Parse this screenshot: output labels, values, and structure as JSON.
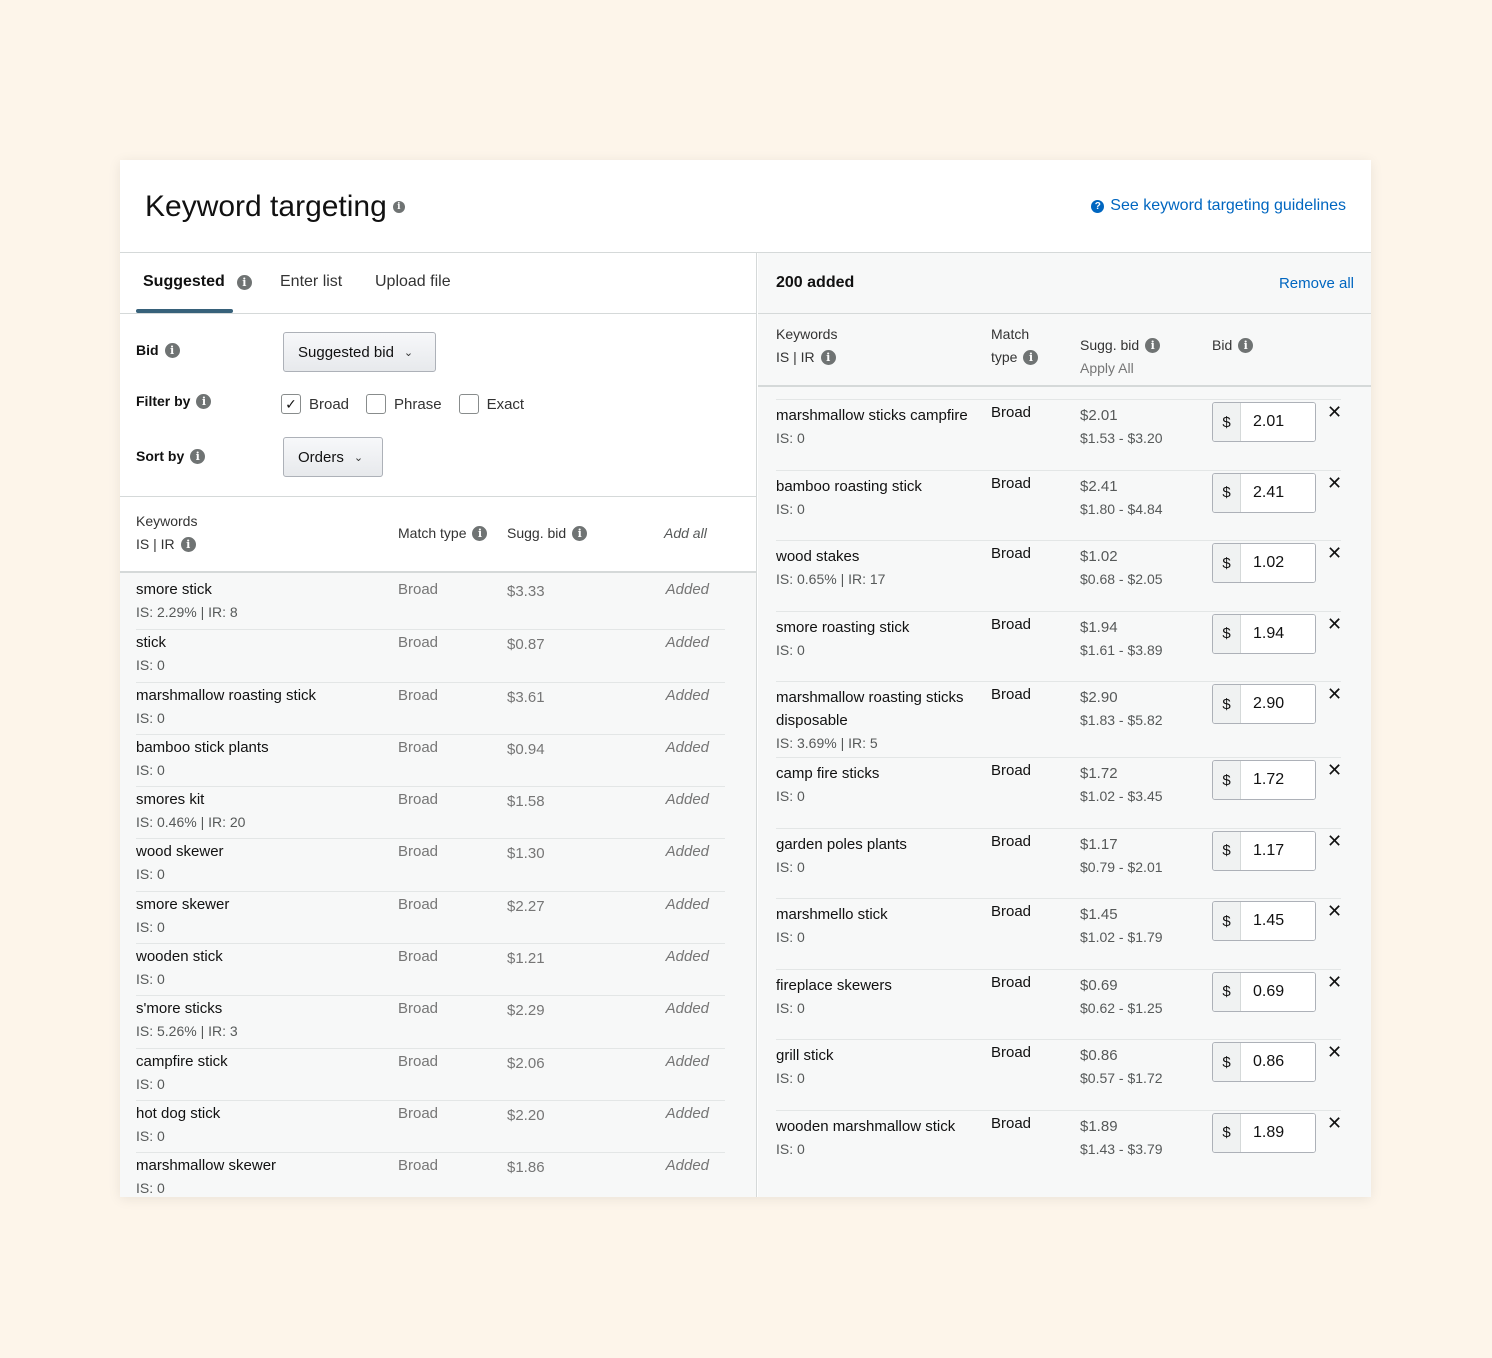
{
  "header": {
    "title": "Keyword targeting",
    "guidelines_link": "See keyword targeting guidelines"
  },
  "left": {
    "tabs": [
      "Suggested",
      "Enter list",
      "Upload file"
    ],
    "bid_label": "Bid",
    "bid_value": "Suggested bid",
    "filter_label": "Filter by",
    "filters": [
      {
        "label": "Broad",
        "checked": true
      },
      {
        "label": "Phrase",
        "checked": false
      },
      {
        "label": "Exact",
        "checked": false
      }
    ],
    "sort_label": "Sort by",
    "sort_value": "Orders",
    "columns": {
      "keywords": "Keywords",
      "is_ir": "IS | IR",
      "match_type": "Match type",
      "sugg_bid": "Sugg. bid",
      "add_all": "Add all"
    },
    "rows": [
      {
        "keyword": "smore stick",
        "is": "IS: 2.29% | IR: 8",
        "match": "Broad",
        "bid": "$3.33",
        "status": "Added"
      },
      {
        "keyword": "stick",
        "is": "IS: 0",
        "match": "Broad",
        "bid": "$0.87",
        "status": "Added"
      },
      {
        "keyword": "marshmallow roasting stick",
        "is": "IS: 0",
        "match": "Broad",
        "bid": "$3.61",
        "status": "Added"
      },
      {
        "keyword": "bamboo stick plants",
        "is": "IS: 0",
        "match": "Broad",
        "bid": "$0.94",
        "status": "Added"
      },
      {
        "keyword": "smores kit",
        "is": "IS: 0.46% | IR: 20",
        "match": "Broad",
        "bid": "$1.58",
        "status": "Added"
      },
      {
        "keyword": "wood skewer",
        "is": "IS: 0",
        "match": "Broad",
        "bid": "$1.30",
        "status": "Added"
      },
      {
        "keyword": "smore skewer",
        "is": "IS: 0",
        "match": "Broad",
        "bid": "$2.27",
        "status": "Added"
      },
      {
        "keyword": "wooden stick",
        "is": "IS: 0",
        "match": "Broad",
        "bid": "$1.21",
        "status": "Added"
      },
      {
        "keyword": "s'more sticks",
        "is": "IS: 5.26% | IR: 3",
        "match": "Broad",
        "bid": "$2.29",
        "status": "Added"
      },
      {
        "keyword": "campfire stick",
        "is": "IS: 0",
        "match": "Broad",
        "bid": "$2.06",
        "status": "Added"
      },
      {
        "keyword": "hot dog stick",
        "is": "IS: 0",
        "match": "Broad",
        "bid": "$2.20",
        "status": "Added"
      },
      {
        "keyword": "marshmallow skewer",
        "is": "IS: 0",
        "match": "Broad",
        "bid": "$1.86",
        "status": "Added"
      }
    ]
  },
  "right": {
    "added_count": "200 added",
    "remove_all": "Remove all",
    "columns": {
      "keywords": "Keywords",
      "is_ir": "IS | IR",
      "match_1": "Match",
      "match_2": "type",
      "sugg_bid": "Sugg. bid",
      "apply_all": "Apply All",
      "bid": "Bid"
    },
    "currency": "$",
    "rows": [
      {
        "keyword": "marshmallow sticks campfire",
        "is": "IS: 0",
        "match": "Broad",
        "sugg": "$2.01",
        "range": "$1.53 - $3.20",
        "bid": "2.01"
      },
      {
        "keyword": "bamboo roasting stick",
        "is": "IS: 0",
        "match": "Broad",
        "sugg": "$2.41",
        "range": "$1.80 - $4.84",
        "bid": "2.41"
      },
      {
        "keyword": "wood stakes",
        "is": "IS: 0.65% | IR: 17",
        "match": "Broad",
        "sugg": "$1.02",
        "range": "$0.68 - $2.05",
        "bid": "1.02"
      },
      {
        "keyword": "smore roasting stick",
        "is": "IS: 0",
        "match": "Broad",
        "sugg": "$1.94",
        "range": "$1.61 - $3.89",
        "bid": "1.94"
      },
      {
        "keyword": "marshmallow roasting sticks disposable",
        "is": "IS: 3.69% | IR: 5",
        "match": "Broad",
        "sugg": "$2.90",
        "range": "$1.83 - $5.82",
        "bid": "2.90"
      },
      {
        "keyword": "camp fire sticks",
        "is": "IS: 0",
        "match": "Broad",
        "sugg": "$1.72",
        "range": "$1.02 - $3.45",
        "bid": "1.72"
      },
      {
        "keyword": "garden poles plants",
        "is": "IS: 0",
        "match": "Broad",
        "sugg": "$1.17",
        "range": "$0.79 - $2.01",
        "bid": "1.17"
      },
      {
        "keyword": "marshmello stick",
        "is": "IS: 0",
        "match": "Broad",
        "sugg": "$1.45",
        "range": "$1.02 - $1.79",
        "bid": "1.45"
      },
      {
        "keyword": "fireplace skewers",
        "is": "IS: 0",
        "match": "Broad",
        "sugg": "$0.69",
        "range": "$0.62 - $1.25",
        "bid": "0.69"
      },
      {
        "keyword": "grill stick",
        "is": "IS: 0",
        "match": "Broad",
        "sugg": "$0.86",
        "range": "$0.57 - $1.72",
        "bid": "0.86"
      },
      {
        "keyword": "wooden marshmallow stick",
        "is": "IS: 0",
        "match": "Broad",
        "sugg": "$1.89",
        "range": "$1.43 - $3.79",
        "bid": "1.89"
      }
    ]
  }
}
